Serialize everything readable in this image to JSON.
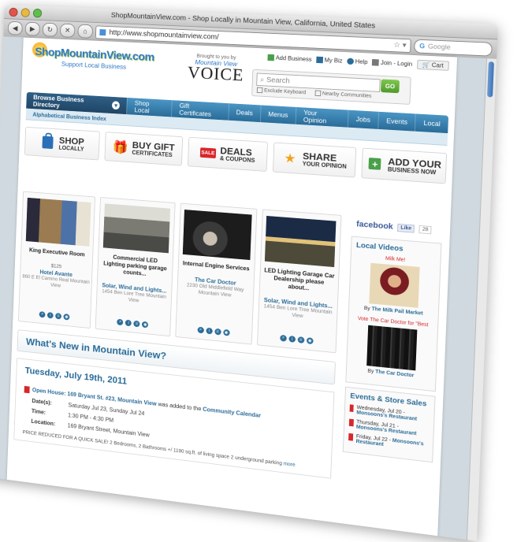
{
  "window": {
    "title": "ShopMountainView.com - Shop Locally in Mountain View, California, United States"
  },
  "browser": {
    "url": "http://www.shopmountainview.com/",
    "search_placeholder": "Google"
  },
  "site": {
    "logo": "ShopMountainView.com",
    "tagline": "Support Local Business",
    "voice_small": "Brought to you by",
    "voice_mv": "Mountain View",
    "voice_big": "VOICE",
    "top_links": [
      "Add Business",
      "My Biz",
      "Help",
      "Join - Login"
    ],
    "cart": "Cart",
    "search_placeholder": "Search",
    "search_button": "GO",
    "search_options": [
      "Exclude Keyboard",
      "Nearby Communities"
    ]
  },
  "nav": {
    "browse": "Browse Business Directory",
    "items": [
      "Shop Local",
      "Gift Certificates",
      "Deals",
      "Menus",
      "Your Opinion",
      "Jobs",
      "Events",
      "Local"
    ]
  },
  "subnav": "Alphabetical Business Index",
  "ctas": [
    {
      "line1": "SHOP",
      "line2": "LOCALLY"
    },
    {
      "line1": "BUY GIFT",
      "line2": "CERTIFICATES"
    },
    {
      "line1": "DEALS",
      "line2": "& COUPONS"
    },
    {
      "line1": "SHARE",
      "line2": "YOUR OPINION"
    },
    {
      "line1": "ADD YOUR",
      "line2": "BUSINESS NOW"
    }
  ],
  "cards": [
    {
      "title": "King Executive Room",
      "price": "$125",
      "biz": "Hotel Avante",
      "addr": "860 E El Camino Real Mountain View"
    },
    {
      "title": "Commercial LED Lighting parking garage counts...",
      "price": "",
      "biz": "Solar, Wind and Lights...",
      "addr": "1454 Ben Lore Tree Mountain View"
    },
    {
      "title": "Internal Engine Services",
      "price": "",
      "biz": "The Car Doctor",
      "addr": "2230 Old Middlefield Way Mountain View"
    },
    {
      "title": "LED Lighting Garage Car Dealership please about...",
      "price": "",
      "biz": "Solar, Wind and Lights...",
      "addr": "1454 Ben Lore Tree Mountain View"
    }
  ],
  "whats_new": "What's New in Mountain View?",
  "event": {
    "date": "Tuesday, July 19th, 2011",
    "link": "Open House: 169 Bryant St. #23, Mountain View",
    "added": "was added to the",
    "calendar": "Community Calendar",
    "labels": {
      "dates": "Date(s):",
      "time": "Time:",
      "location": "Location:"
    },
    "dates": "Saturday Jul 23, Sunday Jul 24",
    "time": "1:30 PM - 4:30 PM",
    "location": "169 Bryant Street, Mountain View",
    "teaser": "PRICE REDUCED FOR A QUICK SALE! 2 Bedrooms, 2 Bathrooms +/ 1190 sq.ft. of living space 2 underground parking",
    "more": "more"
  },
  "sidebar": {
    "facebook": "facebook",
    "like": "Like",
    "like_count": "28",
    "videos_title": "Local Videos",
    "videos": [
      {
        "cap": "Milk Me!",
        "by_pre": "By",
        "by": "The Milk Pail Market"
      },
      {
        "cap": "Vote The Car Doctor for \"Best",
        "by_pre": "By",
        "by": "The Car Doctor"
      }
    ],
    "events_title": "Events & Store Sales",
    "sales": [
      {
        "when": "Wednesday, Jul 20 -",
        "what": "Monsoons's Restaurant"
      },
      {
        "when": "Thursday, Jul 21 -",
        "what": "Monsoons's Restaurant"
      },
      {
        "when": "Friday, Jul 22 -",
        "what": "Monsoons's Restaurant"
      }
    ]
  }
}
